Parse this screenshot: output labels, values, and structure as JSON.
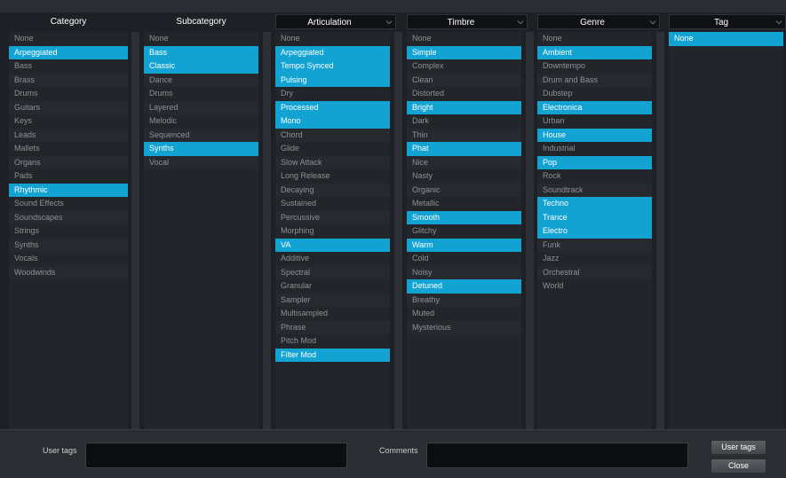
{
  "columns": [
    {
      "header": "Category",
      "items": [
        {
          "label": "None",
          "selected": false
        },
        {
          "label": "Arpeggiated",
          "selected": true
        },
        {
          "label": "Bass",
          "selected": false
        },
        {
          "label": "Brass",
          "selected": false
        },
        {
          "label": "Drums",
          "selected": false
        },
        {
          "label": "Guitars",
          "selected": false
        },
        {
          "label": "Keys",
          "selected": false
        },
        {
          "label": "Leads",
          "selected": false
        },
        {
          "label": "Mallets",
          "selected": false
        },
        {
          "label": "Organs",
          "selected": false
        },
        {
          "label": "Pads",
          "selected": false
        },
        {
          "label": "Rhythmic",
          "selected": true
        },
        {
          "label": "Sound Effects",
          "selected": false
        },
        {
          "label": "Soundscapes",
          "selected": false
        },
        {
          "label": "Strings",
          "selected": false
        },
        {
          "label": "Synths",
          "selected": false
        },
        {
          "label": "Vocals",
          "selected": false
        },
        {
          "label": "Woodwinds",
          "selected": false
        }
      ]
    },
    {
      "header": "Subcategory",
      "items": [
        {
          "label": "None",
          "selected": false
        },
        {
          "label": "Bass",
          "selected": true
        },
        {
          "label": "Classic",
          "selected": true
        },
        {
          "label": "Dance",
          "selected": false
        },
        {
          "label": "Drums",
          "selected": false
        },
        {
          "label": "Layered",
          "selected": false
        },
        {
          "label": "Melodic",
          "selected": false
        },
        {
          "label": "Sequenced",
          "selected": false
        },
        {
          "label": "Synths",
          "selected": true
        },
        {
          "label": "Vocal",
          "selected": false
        }
      ]
    },
    {
      "header": "Articulation",
      "dropdown": true,
      "items": [
        {
          "label": "None",
          "selected": false
        },
        {
          "label": "Arpeggiated",
          "selected": true
        },
        {
          "label": "Tempo Synced",
          "selected": true
        },
        {
          "label": "Pulsing",
          "selected": true
        },
        {
          "label": "Dry",
          "selected": false
        },
        {
          "label": "Processed",
          "selected": true
        },
        {
          "label": "Mono",
          "selected": true
        },
        {
          "label": "Chord",
          "selected": false
        },
        {
          "label": "Glide",
          "selected": false
        },
        {
          "label": "Slow Attack",
          "selected": false
        },
        {
          "label": "Long Release",
          "selected": false
        },
        {
          "label": "Decaying",
          "selected": false
        },
        {
          "label": "Sustained",
          "selected": false
        },
        {
          "label": "Percussive",
          "selected": false
        },
        {
          "label": "Morphing",
          "selected": false
        },
        {
          "label": "VA",
          "selected": true
        },
        {
          "label": "Additive",
          "selected": false
        },
        {
          "label": "Spectral",
          "selected": false
        },
        {
          "label": "Granular",
          "selected": false
        },
        {
          "label": "Sampler",
          "selected": false
        },
        {
          "label": "Multisampled",
          "selected": false
        },
        {
          "label": "Phrase",
          "selected": false
        },
        {
          "label": "Pitch Mod",
          "selected": false
        },
        {
          "label": "Filter Mod",
          "selected": true
        }
      ]
    },
    {
      "header": "Timbre",
      "dropdown": true,
      "items": [
        {
          "label": "None",
          "selected": false
        },
        {
          "label": "Simple",
          "selected": true
        },
        {
          "label": "Complex",
          "selected": false
        },
        {
          "label": "Clean",
          "selected": false
        },
        {
          "label": "Distorted",
          "selected": false
        },
        {
          "label": "Bright",
          "selected": true
        },
        {
          "label": "Dark",
          "selected": false
        },
        {
          "label": "Thin",
          "selected": false
        },
        {
          "label": "Phat",
          "selected": true
        },
        {
          "label": "Nice",
          "selected": false
        },
        {
          "label": "Nasty",
          "selected": false
        },
        {
          "label": "Organic",
          "selected": false
        },
        {
          "label": "Metallic",
          "selected": false
        },
        {
          "label": "Smooth",
          "selected": true
        },
        {
          "label": "Glitchy",
          "selected": false
        },
        {
          "label": "Warm",
          "selected": true
        },
        {
          "label": "Cold",
          "selected": false
        },
        {
          "label": "Noisy",
          "selected": false
        },
        {
          "label": "Detuned",
          "selected": true
        },
        {
          "label": "Breathy",
          "selected": false
        },
        {
          "label": "Muted",
          "selected": false
        },
        {
          "label": "Mysterious",
          "selected": false
        }
      ]
    },
    {
      "header": "Genre",
      "dropdown": true,
      "items": [
        {
          "label": "None",
          "selected": false
        },
        {
          "label": "Ambient",
          "selected": true
        },
        {
          "label": "Downtempo",
          "selected": false
        },
        {
          "label": "Drum and Bass",
          "selected": false
        },
        {
          "label": "Dubstep",
          "selected": false
        },
        {
          "label": "Electronica",
          "selected": true
        },
        {
          "label": "Urban",
          "selected": false
        },
        {
          "label": "House",
          "selected": true
        },
        {
          "label": "Industrial",
          "selected": false
        },
        {
          "label": "Pop",
          "selected": true
        },
        {
          "label": "Rock",
          "selected": false
        },
        {
          "label": "Soundtrack",
          "selected": false
        },
        {
          "label": "Techno",
          "selected": true
        },
        {
          "label": "Trance",
          "selected": true
        },
        {
          "label": "Electro",
          "selected": true
        },
        {
          "label": "Funk",
          "selected": false
        },
        {
          "label": "Jazz",
          "selected": false
        },
        {
          "label": "Orchestral",
          "selected": false
        },
        {
          "label": "World",
          "selected": false
        }
      ]
    },
    {
      "header": "Tag",
      "dropdown": true,
      "items": [
        {
          "label": "None",
          "selected": true
        }
      ]
    }
  ],
  "footer": {
    "user_tags_label": "User tags",
    "user_tags_value": "",
    "comments_label": "Comments",
    "comments_value": "",
    "user_tags_button": "User tags",
    "close_button": "Close"
  },
  "colors": {
    "selection": "#13a3d3",
    "background": "#1d2126",
    "list_background": "#222529",
    "item_text": "#8d9296"
  }
}
